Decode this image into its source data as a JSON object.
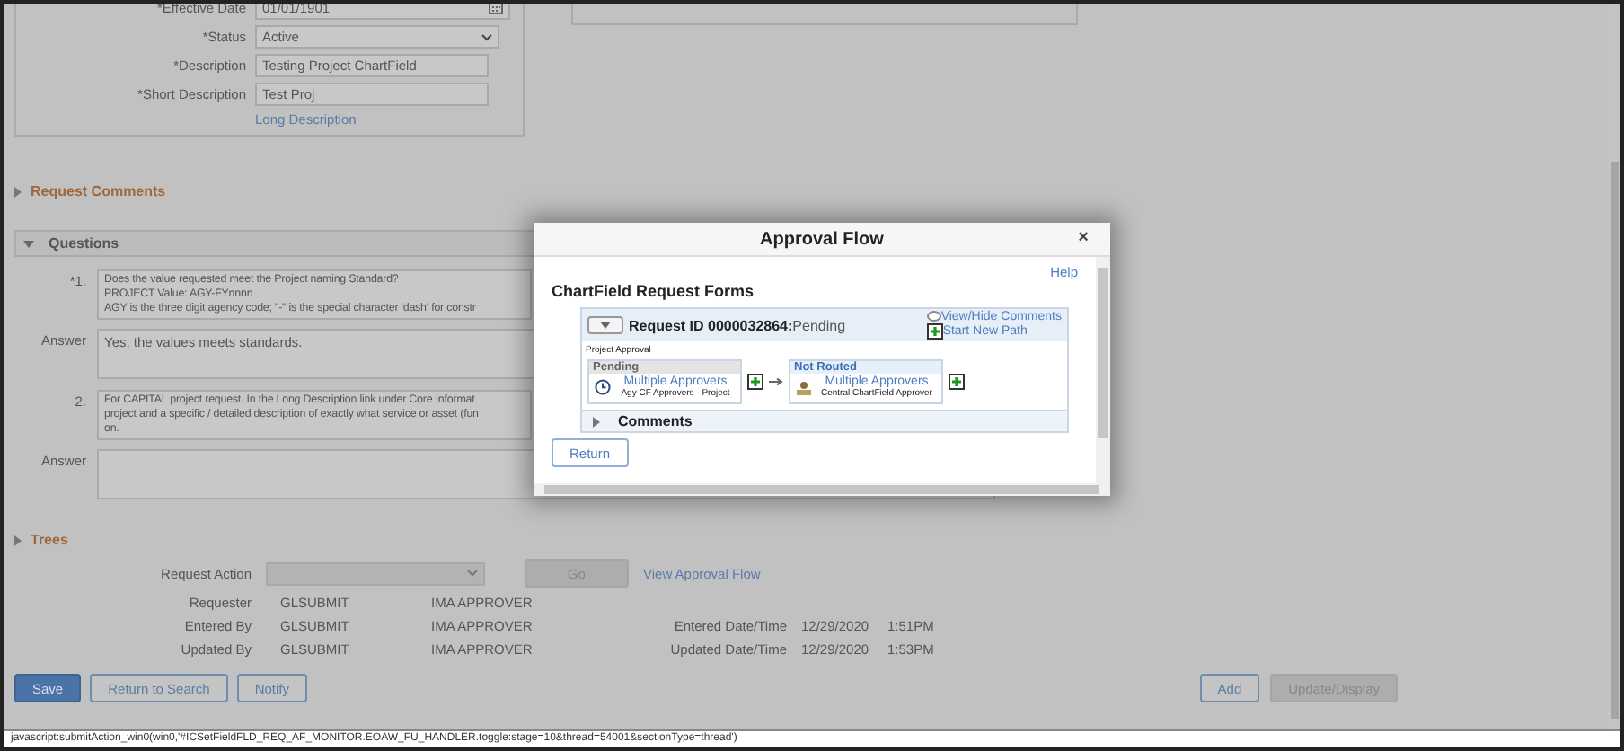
{
  "fields": [
    {
      "label": "*Effective Date",
      "value": "01/01/1901",
      "kind": "date"
    },
    {
      "label": "*Status",
      "value": "Active",
      "kind": "select"
    },
    {
      "label": "*Description",
      "value": "Testing Project ChartField",
      "kind": "text"
    },
    {
      "label": "*Short Description",
      "value": "Test Proj",
      "kind": "text"
    }
  ],
  "long_description_link": "Long Description",
  "request_comments": {
    "title": "Request Comments",
    "expanded": false
  },
  "questions": {
    "title": "Questions",
    "expanded": true,
    "items": [
      {
        "number": "*1.",
        "lines": [
          "Does the value requested meet the Project naming Standard?",
          "PROJECT Value: AGY-FYnnnn",
          "AGY is the three digit agency code; \"-\" is the special character 'dash' for constr"
        ],
        "answer_label": "Answer",
        "answer": "Yes, the values meets standards."
      },
      {
        "number": "2.",
        "lines": [
          "For CAPITAL project request.  In the Long Description link under Core Informat",
          "project and a specific / detailed description of exactly what service or asset (fun",
          "on."
        ],
        "answer_label": "Answer"
      }
    ]
  },
  "trees": {
    "title": "Trees",
    "expanded": false
  },
  "request_action": {
    "label": "Request Action",
    "go": "Go",
    "link": "View Approval Flow"
  },
  "people": [
    {
      "label": "Requester",
      "user": "GLSUBMIT",
      "name": "IMA APPROVER"
    },
    {
      "label": "Entered By",
      "user": "GLSUBMIT",
      "name": "IMA APPROVER",
      "date_label": "Entered Date/Time",
      "date": "12/29/2020",
      "time": "1:51PM"
    },
    {
      "label": "Updated By",
      "user": "GLSUBMIT",
      "name": "IMA APPROVER",
      "date_label": "Updated Date/Time",
      "date": "12/29/2020",
      "time": "1:53PM"
    }
  ],
  "left_buttons": [
    {
      "label": "Save",
      "kind": "primary"
    },
    {
      "label": "Return to Search",
      "kind": "secondary"
    },
    {
      "label": "Notify",
      "kind": "secondary"
    }
  ],
  "right_buttons": [
    {
      "label": "Add",
      "kind": "secondary"
    },
    {
      "label": "Update/Display",
      "kind": "disabled"
    }
  ],
  "status_bar": "javascript:submitAction_win0(win0,'#ICSetFieldFLD_REQ_AF_MONITOR.EOAW_FU_HANDLER.toggle:stage=10&thread=54001&sectionType=thread')",
  "modal": {
    "title": "Approval Flow",
    "close": "×",
    "help": "Help",
    "heading": "ChartField Request Forms",
    "flow_expanded": true,
    "request_id": "Request ID 0000032864:",
    "request_status": "Pending",
    "view_comments": "View/Hide Comments",
    "start_new_path": "Start New Path",
    "stage": "Project Approval",
    "steps": [
      {
        "status": "Pending",
        "kind": "pending",
        "approver": "Multiple Approvers",
        "detail": "Agy CF Approvers - Project"
      },
      {
        "status": "Not Routed",
        "kind": "not_routed",
        "approver": "Multiple Approvers",
        "detail": "Central ChartField Approver"
      }
    ],
    "comments": "Comments",
    "comments_expanded": false,
    "return": "Return"
  }
}
